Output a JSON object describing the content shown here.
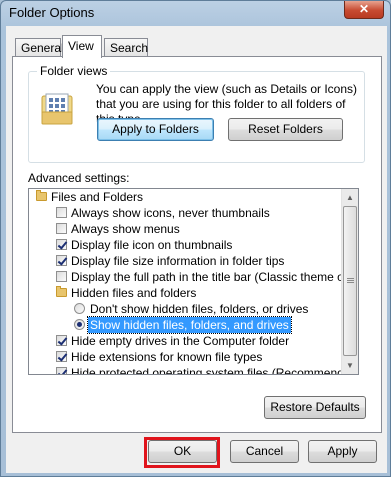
{
  "window": {
    "title": "Folder Options",
    "close_label": "✕"
  },
  "tabs": [
    {
      "label": "General",
      "active": false
    },
    {
      "label": "View",
      "active": true
    },
    {
      "label": "Search",
      "active": false
    }
  ],
  "folder_views": {
    "group_label": "Folder views",
    "description": "You can apply the view (such as Details or Icons) that you are using for this folder to all folders of this type.",
    "apply_button": "Apply to Folders",
    "reset_button": "Reset Folders"
  },
  "advanced": {
    "label": "Advanced settings:",
    "items": [
      {
        "type": "folder",
        "label": "Files and Folders",
        "level": 0
      },
      {
        "type": "checkbox",
        "label": "Always show icons, never thumbnails",
        "checked": false,
        "level": 1
      },
      {
        "type": "checkbox",
        "label": "Always show menus",
        "checked": false,
        "level": 1
      },
      {
        "type": "checkbox",
        "label": "Display file icon on thumbnails",
        "checked": true,
        "level": 1
      },
      {
        "type": "checkbox",
        "label": "Display file size information in folder tips",
        "checked": true,
        "level": 1
      },
      {
        "type": "checkbox",
        "label": "Display the full path in the title bar (Classic theme only)",
        "checked": false,
        "level": 1
      },
      {
        "type": "folder",
        "label": "Hidden files and folders",
        "level": 1
      },
      {
        "type": "radio",
        "label": "Don't show hidden files, folders, or drives",
        "checked": false,
        "level": 2
      },
      {
        "type": "radio",
        "label": "Show hidden files, folders, and drives",
        "checked": true,
        "selected": true,
        "level": 2
      },
      {
        "type": "checkbox",
        "label": "Hide empty drives in the Computer folder",
        "checked": true,
        "level": 1
      },
      {
        "type": "checkbox",
        "label": "Hide extensions for known file types",
        "checked": true,
        "level": 1
      },
      {
        "type": "checkbox",
        "label": "Hide protected operating system files (Recommended)",
        "checked": true,
        "level": 1
      }
    ]
  },
  "restore_button": "Restore Defaults",
  "footer": {
    "ok": "OK",
    "cancel": "Cancel",
    "apply": "Apply"
  },
  "colors": {
    "highlight_box": "#e0141c",
    "selection": "#3399ff"
  }
}
